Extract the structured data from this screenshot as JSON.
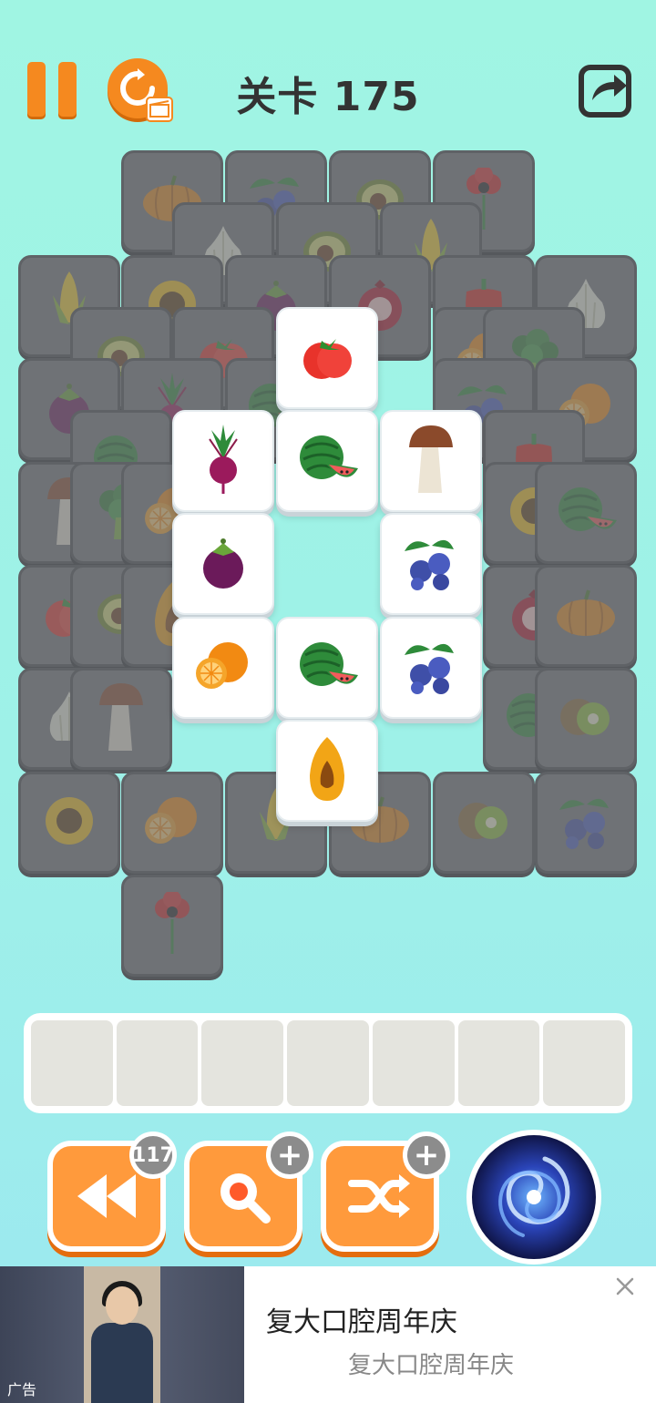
{
  "header": {
    "level_title": "关卡 175"
  },
  "board": {
    "covered_fruits": [
      "pumpkin",
      "blueberries",
      "avocado",
      "flower",
      "garlic",
      "avocado",
      "corn",
      "corn",
      "sunflower",
      "mangosteen",
      "pomegranate",
      "pepper",
      "garlic",
      "avocado",
      "tomato",
      "orange",
      "broccoli",
      "mangosteen",
      "beet",
      "watermelon",
      "blueberries",
      "orange",
      "watermelon",
      "pepper",
      "mushroom",
      "broccoli",
      "orange",
      "sunflower",
      "watermelon",
      "tomato",
      "avocado",
      "papaya",
      "pomegranate",
      "pumpkin",
      "garlic",
      "mushroom",
      "watermelon",
      "kiwi",
      "sunflower",
      "orange",
      "corn",
      "pumpkin",
      "kiwi",
      "blueberries",
      "flower"
    ],
    "free_tiles": [
      "tomato",
      "beet",
      "watermelon",
      "mushroom",
      "mangosteen",
      "blueberries",
      "orange",
      "watermelon",
      "blueberries",
      "papaya"
    ]
  },
  "tray": {
    "slot_count": 7
  },
  "powerups": {
    "undo_count": "117",
    "hint_badge": "+",
    "shuffle_badge": "+"
  },
  "ad": {
    "title": "复大口腔周年庆",
    "subtitle": "复大口腔周年庆",
    "label": "广告"
  }
}
